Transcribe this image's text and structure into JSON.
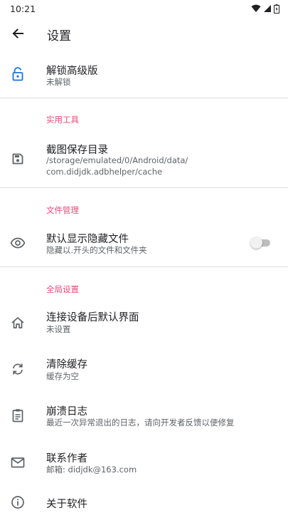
{
  "status_bar": {
    "time": "10:21",
    "icons": [
      "wifi-icon",
      "cell-signal-icon",
      "battery-icon"
    ]
  },
  "app_bar": {
    "back_icon": "arrow-left-icon",
    "title": "设置"
  },
  "colors": {
    "accent": "#e84a7a",
    "primary_icon": "#1a73e8",
    "icon": "#5f6368",
    "divider": "#dadce0"
  },
  "items": {
    "unlock": {
      "icon": "lock-open-icon",
      "title": "解锁高级版",
      "summary": "未解锁"
    },
    "section_tools": "实用工具",
    "screenshot_dir": {
      "icon": "save-icon",
      "title": "截图保存目录",
      "summary_line1": "/storage/emulated/0/Android/data/",
      "summary_line2": "com.didjdk.adbhelper/cache"
    },
    "section_files": "文件管理",
    "show_hidden": {
      "icon": "eye-icon",
      "title": "默认显示隐藏文件",
      "summary": "隐藏以.开头的文件和文件夹",
      "toggle_on": false
    },
    "section_global": "全局设置",
    "default_page": {
      "icon": "home-icon",
      "title": "连接设备后默认界面",
      "summary": "未设置"
    },
    "clear_cache": {
      "icon": "sync-icon",
      "title": "清除缓存",
      "summary": "缓存为空"
    },
    "crash_log": {
      "icon": "clipboard-icon",
      "title": "崩溃日志",
      "summary": "最近一次异常退出的日志，请向开发者反馈以便修复"
    },
    "contact": {
      "icon": "mail-icon",
      "title": "联系作者",
      "summary": "邮箱: didjdk@163.com"
    },
    "about": {
      "icon": "info-icon",
      "title": "关于软件"
    }
  }
}
